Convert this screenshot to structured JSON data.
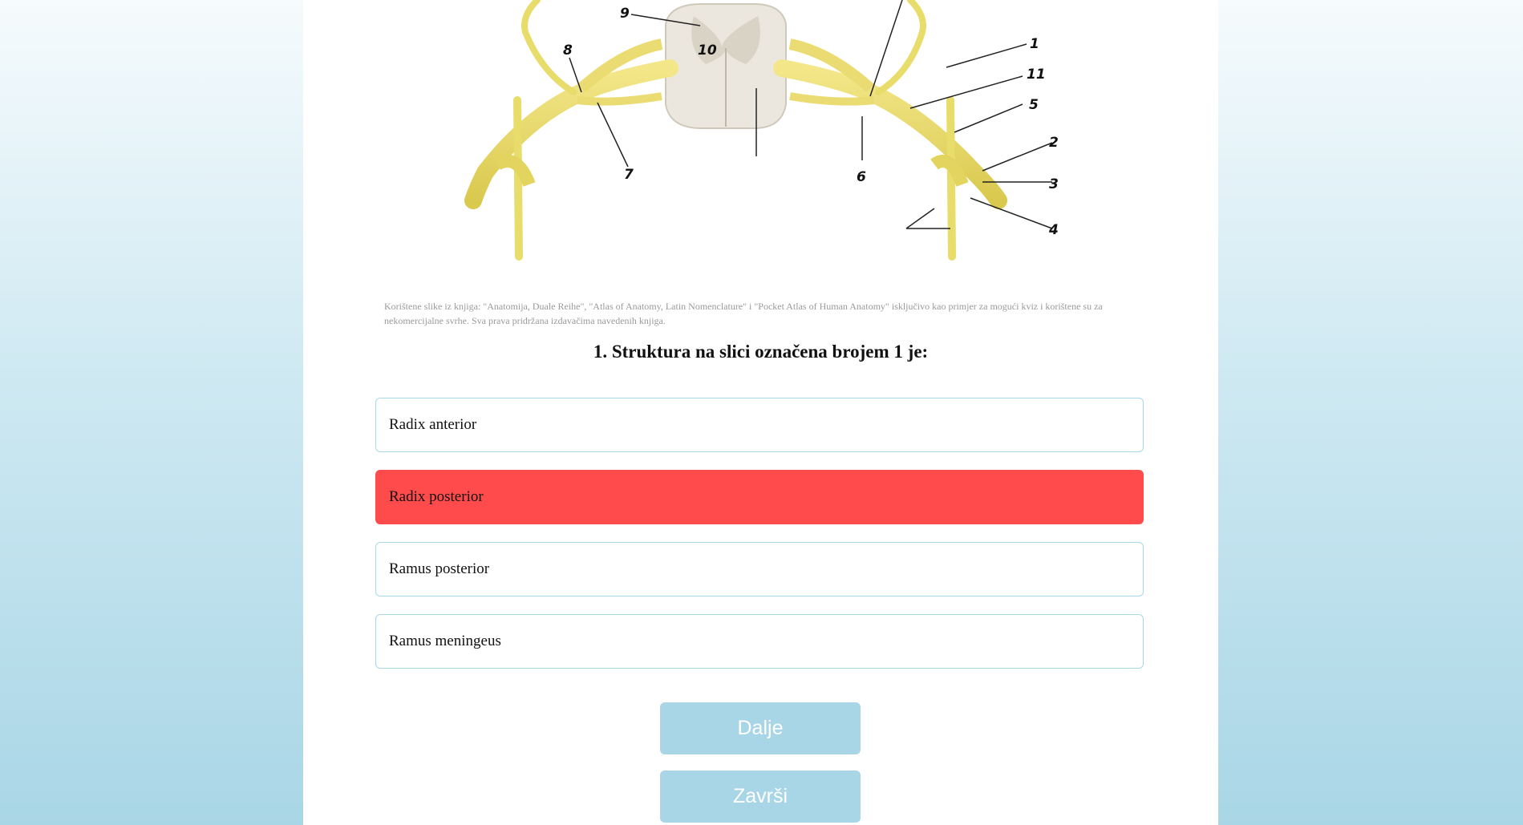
{
  "figure": {
    "labels": [
      "1",
      "2",
      "3",
      "4",
      "5",
      "6",
      "7",
      "8",
      "9",
      "10",
      "11"
    ]
  },
  "caption": "Korištene slike iz knjiga: \"Anatomija, Duale Reihe\", \"Atlas of Anatomy, Latin Nomenclature\" i \"Pocket Atlas of Human Anatomy\" isključivo kao primjer za mogući kviz i korištene su za nekomercijalne svrhe. Sva prava pridržana izdavačima navedenih knjiga.",
  "question": "1. Struktura na slici označena brojem 1 je:",
  "answers": [
    {
      "label": "Radix anterior",
      "state": "normal"
    },
    {
      "label": "Radix posterior",
      "state": "wrong"
    },
    {
      "label": "Ramus posterior",
      "state": "normal"
    },
    {
      "label": "Ramus meningeus",
      "state": "normal"
    }
  ],
  "buttons": {
    "next": "Dalje",
    "finish": "Završi"
  },
  "colors": {
    "wrong": "#ff4b4b",
    "button": "#a9d6e6",
    "answer_border": "#a8d7e6",
    "nerve": "#e8dc6a"
  }
}
